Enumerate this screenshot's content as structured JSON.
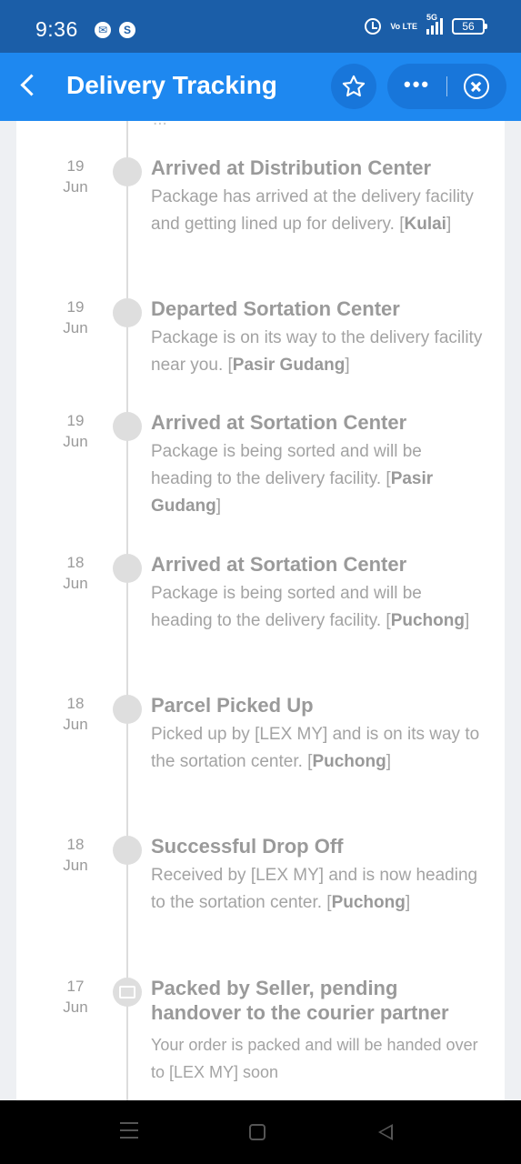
{
  "status_bar": {
    "time": "9:36",
    "battery": "56",
    "network": "5G",
    "volte_label": "Vo LTE",
    "notification_icons": [
      "messenger-icon",
      "s-icon"
    ]
  },
  "header": {
    "title": "Delivery Tracking",
    "background": "#1e88f0"
  },
  "timeline": {
    "peek_text": "...",
    "events": [
      {
        "day": "19",
        "month": "Jun",
        "title": "Arrived at Distribution Center",
        "desc": "Package has arrived at the delivery facility and getting lined up for delivery. [",
        "location": "Kulai",
        "suffix": "]"
      },
      {
        "day": "19",
        "month": "Jun",
        "title": "Departed Sortation Center",
        "desc": "Package is on its way to the delivery facility near you. [",
        "location": "Pasir Gudang",
        "suffix": "]"
      },
      {
        "day": "19",
        "month": "Jun",
        "title": "Arrived at Sortation Center",
        "desc": "Package is being sorted and will be heading to the delivery facility. [",
        "location": "Pasir Gudang",
        "suffix": "]"
      },
      {
        "day": "18",
        "month": "Jun",
        "title": "Arrived at Sortation Center",
        "desc": "Package is being sorted and will be heading to the delivery facility. [",
        "location": "Puchong",
        "suffix": "]"
      },
      {
        "day": "18",
        "month": "Jun",
        "title": "Parcel Picked Up",
        "desc": "Picked up by [LEX MY] and is on its way to the sortation center. [",
        "location": "Puchong",
        "suffix": "]"
      },
      {
        "day": "18",
        "month": "Jun",
        "title": "Successful Drop Off",
        "desc": "Received by [LEX MY] and is now heading to the sortation center. [",
        "location": "Puchong",
        "suffix": "]"
      },
      {
        "day": "17",
        "month": "Jun",
        "title": "Packed by Seller, pending handover to the courier partner",
        "desc": "Your order is packed and will be handed over to [LEX MY] soon",
        "location": "",
        "suffix": ""
      }
    ]
  },
  "nav_icons": [
    "menu-icon",
    "home-icon",
    "back-icon"
  ]
}
